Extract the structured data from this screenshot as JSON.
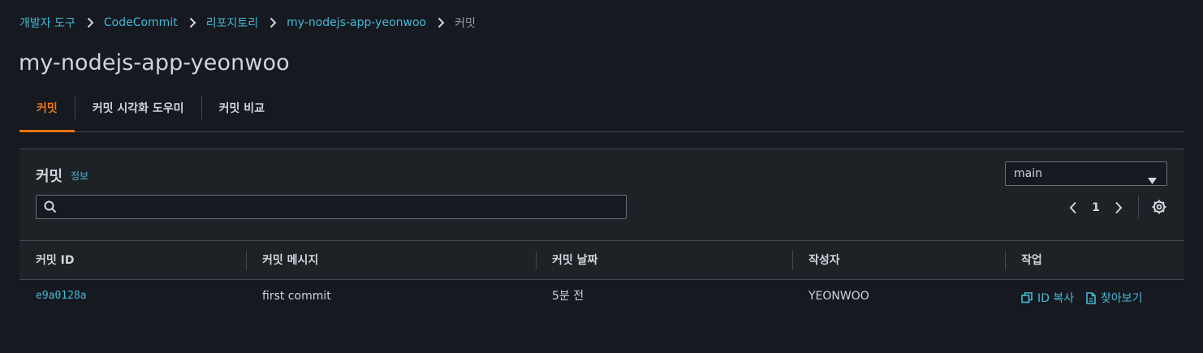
{
  "breadcrumb": {
    "items": [
      "개발자 도구",
      "CodeCommit",
      "리포지토리",
      "my-nodejs-app-yeonwoo"
    ],
    "current": "커밋"
  },
  "page": {
    "title": "my-nodejs-app-yeonwoo"
  },
  "tabs": [
    {
      "label": "커밋",
      "active": true
    },
    {
      "label": "커밋 시각화 도우미",
      "active": false
    },
    {
      "label": "커밋 비교",
      "active": false
    }
  ],
  "panel": {
    "title": "커밋",
    "info_link": "정보",
    "search": {
      "value": "",
      "placeholder": ""
    },
    "branch_select": {
      "selected": "main"
    },
    "pagination": {
      "current_page": "1"
    }
  },
  "table": {
    "columns": [
      "커밋 ID",
      "커밋 메시지",
      "커밋 날짜",
      "작성자",
      "작업"
    ],
    "rows": [
      {
        "commit_id": "e9a0128a",
        "message": "first commit",
        "date": "5분 전",
        "author": "YEONWOO",
        "actions": {
          "copy_id": "ID 복사",
          "browse": "찾아보기"
        }
      }
    ]
  },
  "colors": {
    "background": "#16191f",
    "accent": "#ec7211",
    "link": "#44b9d6",
    "text": "#d1d5db"
  }
}
